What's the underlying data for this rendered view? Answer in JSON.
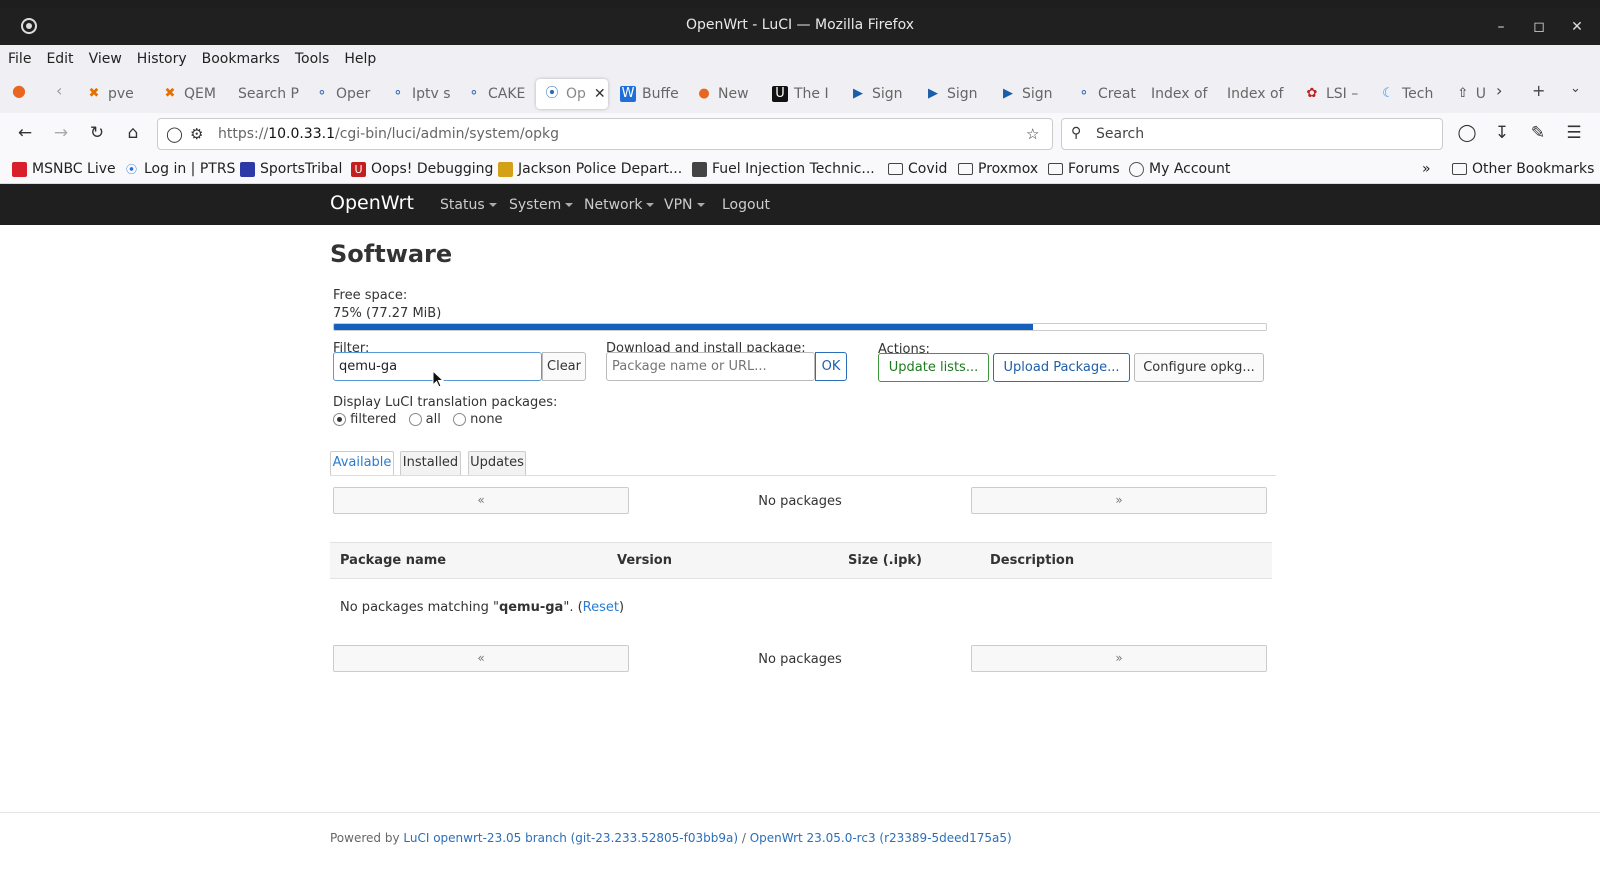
{
  "window": {
    "title": "OpenWrt - LuCI — Mozilla Firefox"
  },
  "menubar": [
    "File",
    "Edit",
    "View",
    "History",
    "Bookmarks",
    "Tools",
    "Help"
  ],
  "tabs": [
    {
      "label": "pve",
      "icon": "proxmox-icon"
    },
    {
      "label": "QEM",
      "icon": "proxmox-icon"
    },
    {
      "label": "Search P",
      "icon": ""
    },
    {
      "label": "Oper",
      "icon": "openwrt-icon"
    },
    {
      "label": "Iptv s",
      "icon": "openwrt-icon"
    },
    {
      "label": "CAKE",
      "icon": "openwrt-icon"
    },
    {
      "label": "Op",
      "icon": "wireless-icon",
      "active": true
    },
    {
      "label": "Buffe",
      "icon": "w-icon"
    },
    {
      "label": "New",
      "icon": "firefox-icon"
    },
    {
      "label": "The I",
      "icon": "u-icon"
    },
    {
      "label": "Sign",
      "icon": "play-icon"
    },
    {
      "label": "Sign",
      "icon": "play-icon"
    },
    {
      "label": "Sign",
      "icon": "play-icon"
    },
    {
      "label": "Creat",
      "icon": "openwrt-icon"
    },
    {
      "label": "Index of",
      "icon": ""
    },
    {
      "label": "Index of",
      "icon": ""
    },
    {
      "label": "LSI –",
      "icon": "paw-icon"
    },
    {
      "label": "Tech",
      "icon": "tech-icon"
    },
    {
      "label": "U",
      "icon": "upload-icon"
    }
  ],
  "nav": {
    "url_prefix": "https://",
    "url_host": "10.0.33.1",
    "url_path": "/cgi-bin/luci/admin/system/opkg",
    "search_placeholder": "Search"
  },
  "bookmarks": [
    {
      "label": "MSNBC Live",
      "color": "#d9202a"
    },
    {
      "label": "Log in | PTRS",
      "color": "#1e6fd9"
    },
    {
      "label": "SportsTribal",
      "color": "#2c3aa8"
    },
    {
      "label": "Oops! Debugging",
      "color": "#c21f1f"
    },
    {
      "label": "Jackson Police Depart...",
      "color": "#d4a017"
    },
    {
      "label": "Fuel Injection Technic...",
      "color": "#444444"
    },
    {
      "label": "Covid",
      "folder": true
    },
    {
      "label": "Proxmox",
      "folder": true
    },
    {
      "label": "Forums",
      "folder": true
    },
    {
      "label": "My Account",
      "color": "#555555"
    }
  ],
  "other_bookmarks": "Other Bookmarks",
  "luci": {
    "brand": "OpenWrt",
    "menu": [
      "Status",
      "System",
      "Network",
      "VPN",
      "Logout"
    ],
    "page_title": "Software",
    "free_space_label": "Free space:",
    "free_space_value": "75% (77.27 MiB)",
    "free_space_fraction": 0.75,
    "filter_label": "Filter:",
    "filter_value": "qemu-ga",
    "clear_button": "Clear",
    "download_label": "Download and install package:",
    "download_placeholder": "Package name or URL...",
    "ok_button": "OK",
    "actions_label": "Actions:",
    "update_lists_button": "Update lists...",
    "upload_package_button": "Upload Package...",
    "configure_button": "Configure opkg...",
    "translation_label": "Display LuCI translation packages:",
    "translation_options": [
      "filtered",
      "all",
      "none"
    ],
    "translation_selected": "filtered",
    "tabs": [
      "Available",
      "Installed",
      "Updates"
    ],
    "active_tab": "Available",
    "pager_prev": "«",
    "pager_next": "»",
    "no_packages": "No packages",
    "columns": [
      "Package name",
      "Version",
      "Size (.ipk)",
      "Description"
    ],
    "no_match_prefix": "No packages matching \"",
    "no_match_term": "qemu-ga",
    "no_match_suffix": "\". (",
    "reset_link": "Reset",
    "no_match_end": ")",
    "footer_prefix": "Powered by",
    "footer_luci": "LuCI openwrt-23.05 branch (git-23.233.52805-f03bb9a)",
    "footer_sep": "/",
    "footer_openwrt": "OpenWrt 23.05.0-rc3 (r23389-5deed175a5)"
  }
}
